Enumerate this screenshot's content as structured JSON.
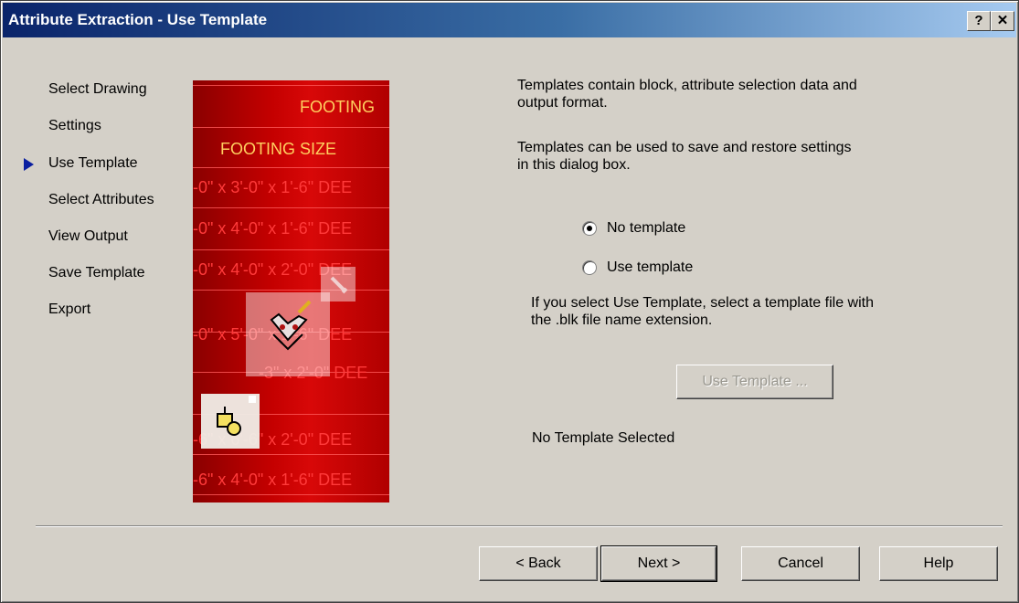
{
  "window": {
    "title": "Attribute Extraction - Use Template",
    "help_label": "?",
    "close_label": "✕"
  },
  "nav": {
    "items": [
      {
        "label": "Select Drawing"
      },
      {
        "label": "Settings"
      },
      {
        "label": "Use Template",
        "current": true
      },
      {
        "label": "Select Attributes"
      },
      {
        "label": "View Output"
      },
      {
        "label": "Save Template"
      },
      {
        "label": "Export"
      }
    ]
  },
  "illustration": {
    "header1": "FOOTING",
    "header2": "FOOTING SIZE",
    "rows": [
      "-0\" x 3'-0\" x 1'-6\" DEE",
      "-0\" x 4'-0\" x 1'-6\" DEE",
      "-0\" x 4'-0\" x 2'-0\" DEE",
      "-0\" x 5'-0\" x 1'-6\" DEE",
      "-3\" x 2'-0\" DEE",
      "-6\" x 6'-6\" x 2'-0\" DEE",
      "-6\" x 4'-0\" x 1'-6\" DEE"
    ]
  },
  "main": {
    "description1": "Templates contain block, attribute selection data and output format.",
    "description2": "Templates can be used to save and restore settings in this dialog box.",
    "options": {
      "no_template": "No template",
      "use_template": "Use template",
      "selected": "no_template"
    },
    "hint": "If you select Use Template, select a template file with the .blk file name extension.",
    "use_template_button": "Use Template ...",
    "status": "No Template Selected"
  },
  "footer": {
    "back": "< Back",
    "next": "Next >",
    "cancel": "Cancel",
    "help": "Help"
  }
}
